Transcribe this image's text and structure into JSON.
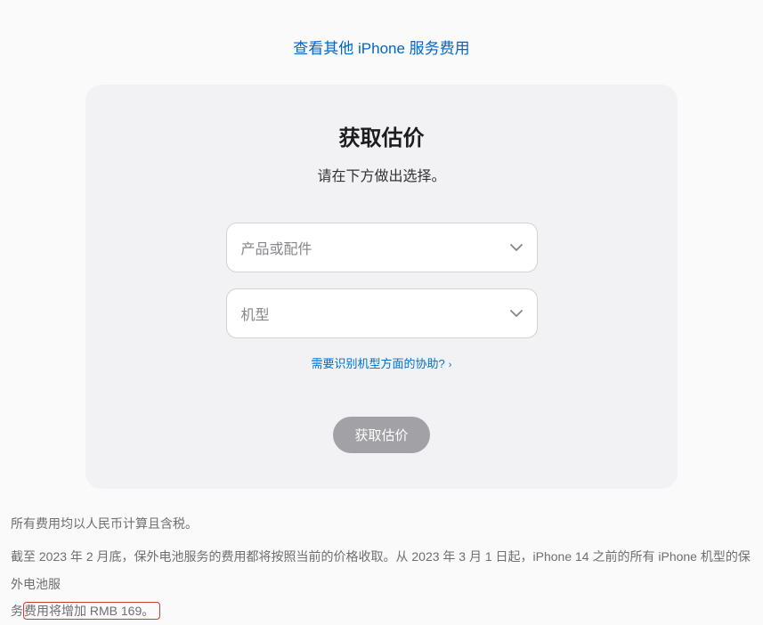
{
  "topLink": "查看其他 iPhone 服务费用",
  "card": {
    "title": "获取估价",
    "subtitle": "请在下方做出选择。",
    "select1": {
      "placeholder": "产品或配件"
    },
    "select2": {
      "placeholder": "机型"
    },
    "helpLink": "需要识别机型方面的协助?",
    "button": "获取估价"
  },
  "footer": {
    "line1": "所有费用均以人民币计算且含税。",
    "line2_part1": "截至 2023 年 2 月底，保外电池服务的费用都将按照当前的价格收取。从 2023 年 3 月 1 日起，iPhone 14 之前的所有 iPhone 机型的保外电池服",
    "line2_orphan": "务",
    "line2_highlight": "费用将增加 RMB 169。"
  }
}
